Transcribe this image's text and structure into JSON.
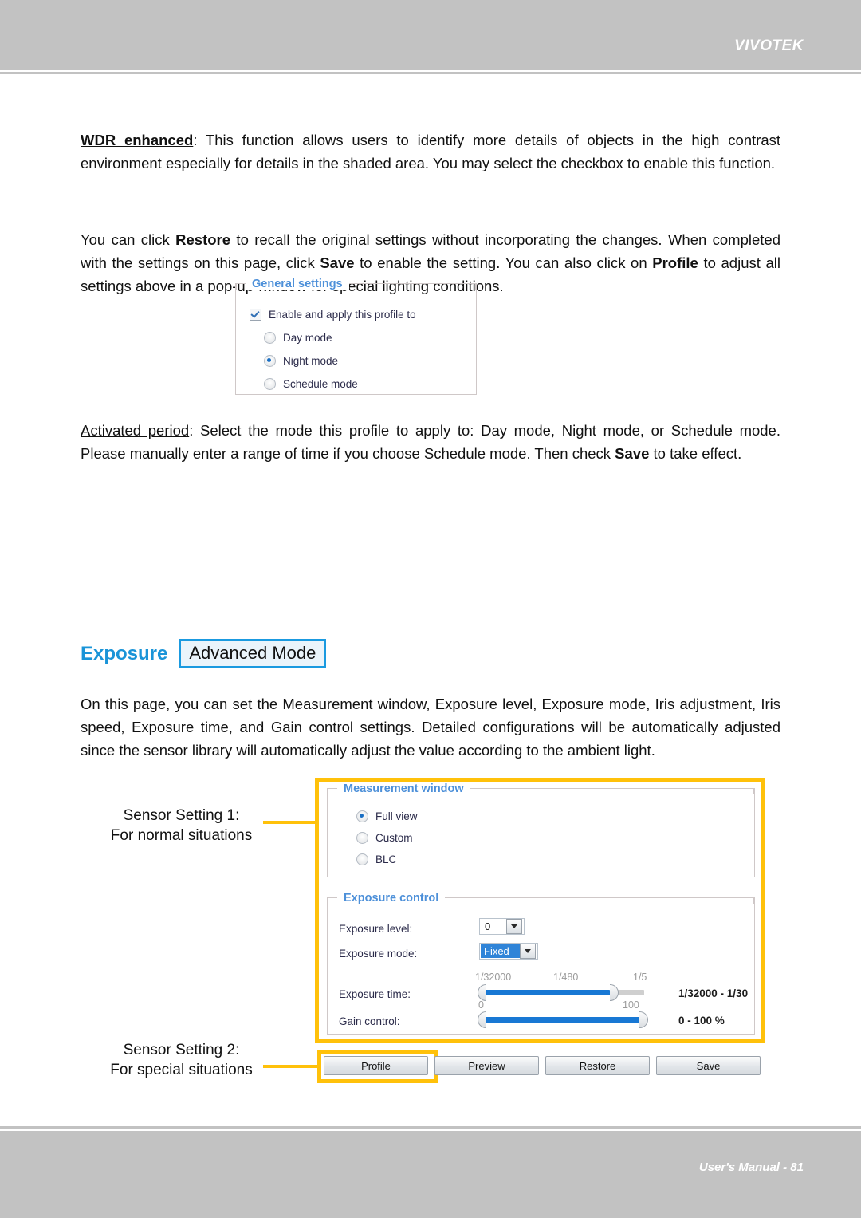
{
  "header": {
    "brand": "VIVOTEK"
  },
  "footer": {
    "text": "User's Manual - 81"
  },
  "paragraphs": {
    "wdr": "WDR enhanced: This function allows users to identify more details of objects in the high contrast environment especially for details in the shaded area. You may select the checkbox to enable this function.",
    "wdr_term": "WDR enhanced",
    "restore": "You can click Restore to recall the original settings without incorporating the changes. When completed with the settings on this page, click Save to enable the setting. You can also click on Profile to adjust all settings above in a pop-up window for special lighting conditions.",
    "activated": "Activated period: Select the mode this profile to apply to: Day mode, Night mode, or Schedule mode. Please manually enter a range of time if you choose Schedule mode. Then check Save to take effect.",
    "activated_term": "Activated period",
    "exposure_desc": "On this page, you can set the Measurement window, Exposure level, Exposure mode, Iris adjustment, Iris speed, Exposure time, and Gain control settings. Detailed configurations will be automatically adjusted since the sensor library will automatically adjust the value according to the ambient light."
  },
  "exposure_heading": {
    "title": "Exposure",
    "badge": "Advanced Mode",
    "title_color": "#1a94d8",
    "badge_border_color": "#1a9ae0"
  },
  "general_settings": {
    "legend": "General settings",
    "enable_label": "Enable and apply this profile to",
    "enable_checked": true,
    "modes": [
      {
        "label": "Day mode",
        "selected": false
      },
      {
        "label": "Night mode",
        "selected": true
      },
      {
        "label": "Schedule mode",
        "selected": false
      }
    ]
  },
  "measurement_window": {
    "legend": "Measurement window",
    "options": [
      {
        "label": "Full view",
        "selected": true
      },
      {
        "label": "Custom",
        "selected": false
      },
      {
        "label": "BLC",
        "selected": false
      }
    ]
  },
  "exposure_control": {
    "legend": "Exposure control",
    "exposure_level": {
      "label": "Exposure level:",
      "value": "0"
    },
    "exposure_mode": {
      "label": "Exposure mode:",
      "value": "Fixed",
      "highlighted": true
    },
    "exposure_time": {
      "label": "Exposure time:",
      "ticks": [
        "1/32000",
        "1/480",
        "1/5"
      ],
      "range_text": "1/32000 - 1/30",
      "fill_start_pct": 0,
      "fill_end_pct": 79
    },
    "gain_control": {
      "label": "Gain control:",
      "ticks": [
        "0",
        "100"
      ],
      "range_text": "0 - 100 %",
      "fill_start_pct": 0,
      "fill_end_pct": 100
    }
  },
  "buttons": [
    {
      "label": "Profile"
    },
    {
      "label": "Preview"
    },
    {
      "label": "Restore"
    },
    {
      "label": "Save"
    }
  ],
  "annotations": {
    "sensor1": "Sensor Setting 1:\nFor normal situations",
    "sensor2": "Sensor Setting 2:\nFor special situations",
    "callout_color": "#ffc10a"
  }
}
